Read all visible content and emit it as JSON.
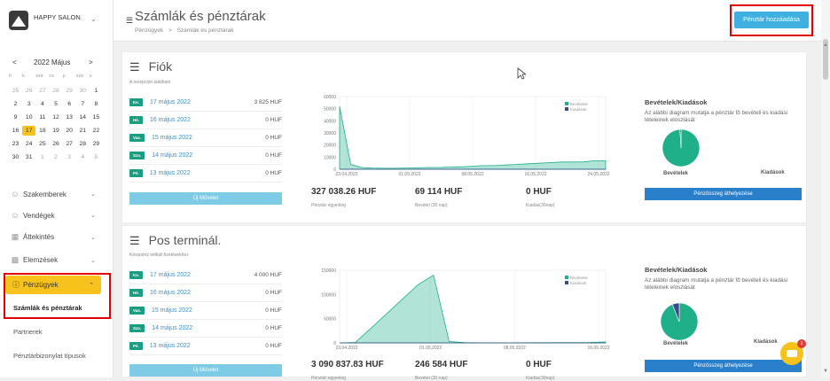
{
  "brand": {
    "name": "HAPPY SALON"
  },
  "calendar": {
    "title": "2022 Május",
    "prev": "<",
    "next": ">",
    "weekdays": [
      "h",
      "k",
      "sze",
      "cs",
      "p",
      "szo",
      "v"
    ],
    "days": [
      [
        "25",
        "o"
      ],
      [
        "26",
        "o"
      ],
      [
        "27",
        "o"
      ],
      [
        "28",
        "o"
      ],
      [
        "29",
        "o"
      ],
      [
        "30",
        "o"
      ],
      [
        "1",
        ""
      ],
      [
        "2",
        ""
      ],
      [
        "3",
        ""
      ],
      [
        "4",
        ""
      ],
      [
        "5",
        ""
      ],
      [
        "6",
        ""
      ],
      [
        "7",
        ""
      ],
      [
        "8",
        ""
      ],
      [
        "9",
        ""
      ],
      [
        "10",
        ""
      ],
      [
        "11",
        ""
      ],
      [
        "12",
        ""
      ],
      [
        "13",
        ""
      ],
      [
        "14",
        ""
      ],
      [
        "15",
        ""
      ],
      [
        "16",
        ""
      ],
      [
        "17",
        "t"
      ],
      [
        "18",
        ""
      ],
      [
        "19",
        ""
      ],
      [
        "20",
        ""
      ],
      [
        "21",
        ""
      ],
      [
        "22",
        ""
      ],
      [
        "23",
        ""
      ],
      [
        "24",
        ""
      ],
      [
        "25",
        ""
      ],
      [
        "26",
        ""
      ],
      [
        "27",
        ""
      ],
      [
        "28",
        ""
      ],
      [
        "29",
        ""
      ],
      [
        "30",
        ""
      ],
      [
        "31",
        ""
      ],
      [
        "1",
        "o"
      ],
      [
        "2",
        "o"
      ],
      [
        "3",
        "o"
      ],
      [
        "4",
        "o"
      ],
      [
        "5",
        "o"
      ]
    ]
  },
  "nav": [
    {
      "label": "Szakemberek",
      "icon": "user-icon"
    },
    {
      "label": "Vendégek",
      "icon": "users-icon"
    },
    {
      "label": "Áttekintés",
      "icon": "grid-icon"
    },
    {
      "label": "Elemzések",
      "icon": "chart-icon"
    }
  ],
  "finance": {
    "label": "Pénzügyek",
    "icon": "coin-icon",
    "items": [
      "Számlák és pénztárak",
      "Partnerek",
      "Pénztárbizonylat típusok"
    ]
  },
  "header": {
    "title": "Számlák és pénztárak",
    "breadcrumb": [
      "Pénzügyek",
      ">",
      "Számlák és pénztárak"
    ],
    "add_button": "Pénztár hozzáadása"
  },
  "accounts": [
    {
      "title": "Fiók",
      "subtitle": "A recepción található",
      "rows": [
        {
          "badge": "Ke.",
          "date": "17 május 2022",
          "amount": "3 825 HUF"
        },
        {
          "badge": "Hé.",
          "date": "16 május 2022",
          "amount": "0 HUF"
        },
        {
          "badge": "Vas.",
          "date": "15 május 2022",
          "amount": "0 HUF"
        },
        {
          "badge": "Szo.",
          "date": "14 május 2022",
          "amount": "0 HUF"
        },
        {
          "badge": "Pé.",
          "date": "13 május 2022",
          "amount": "0 HUF"
        }
      ],
      "op_button": "Új Művelet",
      "stats": [
        {
          "value": "327 038.26 HUF",
          "label": "Pénztár egyenleg"
        },
        {
          "value": "69 114 HUF",
          "label": "Bevétel (30 nap)"
        },
        {
          "value": "0 HUF",
          "label": "Kiadás(30nap)"
        }
      ],
      "side_title": "Bevételek/Kiadások",
      "side_desc": "Az alábbi diagram mutatja a pénztár fő bevételi és kiadási tételeinek eloszlását",
      "pie_labels": [
        "Bevételek",
        "Kiadások"
      ],
      "transfer_button": "Pénzösszeg áthelyezése"
    },
    {
      "title": "Pos terminál.",
      "subtitle": "Készpénz nélküli fizetésekhez",
      "rows": [
        {
          "badge": "Ke.",
          "date": "17 május 2022",
          "amount": "4 000 HUF"
        },
        {
          "badge": "Hé.",
          "date": "16 május 2022",
          "amount": "0 HUF"
        },
        {
          "badge": "Vas.",
          "date": "15 május 2022",
          "amount": "0 HUF"
        },
        {
          "badge": "Szo.",
          "date": "14 május 2022",
          "amount": "0 HUF"
        },
        {
          "badge": "Pé.",
          "date": "13 május 2022",
          "amount": "0 HUF"
        }
      ],
      "op_button": "Új Művelet",
      "stats": [
        {
          "value": "3 090 837.83 HUF",
          "label": "Pénztár egyenleg"
        },
        {
          "value": "246 584 HUF",
          "label": "Bevétel (30 nap)"
        },
        {
          "value": "0 HUF",
          "label": "Kiadás(30nap)"
        }
      ],
      "side_title": "Bevételek/Kiadások",
      "side_desc": "Az alábbi diagram mutatja a pénztár fő bevételi és kiadási tételeinek eloszlását",
      "pie_labels": [
        "Bevételek",
        "Kiadások"
      ],
      "transfer_button": "Pénzösszeg áthelyezése"
    }
  ],
  "colors": {
    "accent": "#f7c21b",
    "income": "#1fb08a",
    "expense": "#3a4a8c",
    "button": "#2a7fcb"
  },
  "chat": {
    "badge": "1"
  },
  "chart_data": [
    {
      "type": "area",
      "series": [
        {
          "name": "Bevételek",
          "values": [
            52000,
            4000,
            1500,
            1000,
            800,
            800,
            1000,
            1200,
            1500,
            1500,
            1800,
            2000,
            2500,
            3000,
            3000,
            3500,
            4000,
            4500,
            5000,
            5500,
            6000,
            6000,
            6000,
            7000,
            7000
          ]
        },
        {
          "name": "Kiadások",
          "values": [
            0,
            0,
            0,
            0,
            0,
            0,
            0,
            0,
            0,
            0,
            0,
            0,
            0,
            0,
            0,
            0,
            0,
            0,
            0,
            0,
            0,
            0,
            0,
            0,
            0
          ]
        }
      ],
      "xticks": [
        "23.04.2022",
        "01.05.2022",
        "08.05.2022",
        "16.05.2022",
        "24.05.2022"
      ],
      "yticks": [
        "0",
        "10000",
        "20000",
        "30000",
        "40000",
        "50000",
        "60000"
      ],
      "ylim": [
        0,
        60000
      ]
    },
    {
      "type": "area",
      "series": [
        {
          "name": "Bevételek",
          "values": [
            0,
            1000,
            30000,
            60000,
            90000,
            120000,
            140000,
            3000,
            500,
            200,
            200,
            200,
            300,
            400,
            500,
            800,
            1000,
            2000
          ]
        },
        {
          "name": "Kiadások",
          "values": [
            0,
            0,
            0,
            0,
            0,
            0,
            0,
            0,
            0,
            0,
            0,
            0,
            0,
            0,
            0,
            0,
            0,
            0
          ]
        }
      ],
      "xticks": [
        "23.04.2022",
        "01.05.2022",
        "08.05.2022",
        "16.05.2022"
      ],
      "yticks": [
        "0",
        "50000",
        "100000",
        "150000"
      ],
      "ylim": [
        0,
        150000
      ]
    },
    {
      "type": "pie",
      "values": [
        99,
        1
      ],
      "labels": [
        "Bevételek",
        "Kiadások"
      ]
    },
    {
      "type": "pie",
      "values": [
        94,
        6
      ],
      "labels": [
        "Bevételek",
        "Kiadások"
      ]
    }
  ]
}
